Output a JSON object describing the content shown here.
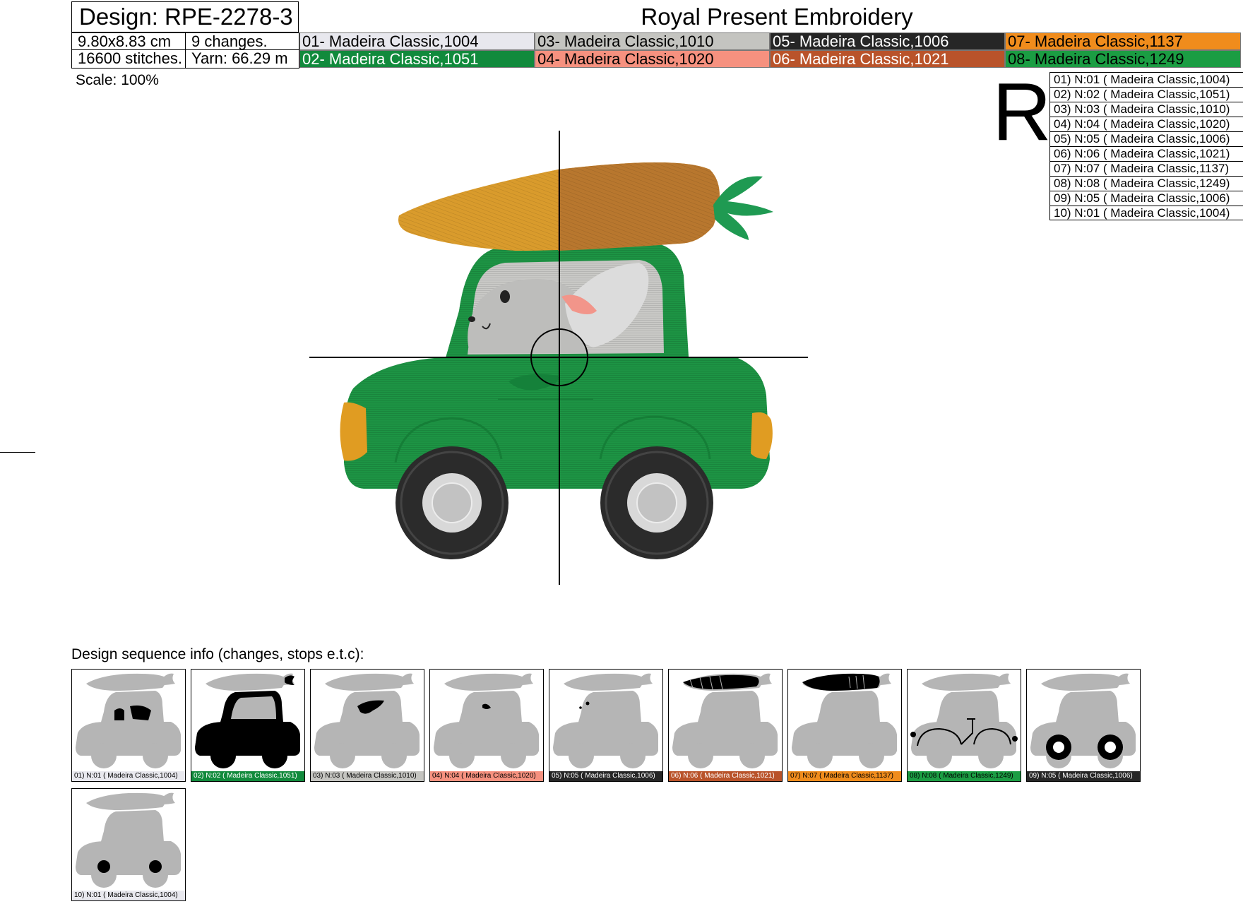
{
  "header": {
    "design": "Design: RPE-2278-3",
    "brand": "Royal Present Embroidery",
    "size": "9.80x8.83 cm",
    "changes": "9 changes.",
    "stitches": "16600 stitches.",
    "yarn": "Yarn: 66.29 m"
  },
  "colors": [
    {
      "label": "01- Madeira Classic,1004",
      "bg": "#e8e8ee",
      "fg": "#000000"
    },
    {
      "label": "02- Madeira Classic,1051",
      "bg": "#118a3c",
      "fg": "#ffffff"
    },
    {
      "label": "03- Madeira Classic,1010",
      "bg": "#c4c4c0",
      "fg": "#000000"
    },
    {
      "label": "04- Madeira Classic,1020",
      "bg": "#f6917f",
      "fg": "#000000"
    },
    {
      "label": "05- Madeira Classic,1006",
      "bg": "#262626",
      "fg": "#ffffff"
    },
    {
      "label": "06- Madeira Classic,1021",
      "bg": "#b9532a",
      "fg": "#ffffff"
    },
    {
      "label": "07- Madeira Classic,1137",
      "bg": "#f08c1c",
      "fg": "#000000"
    },
    {
      "label": "08- Madeira Classic,1249",
      "bg": "#1b9d43",
      "fg": "#000000"
    }
  ],
  "scale": "Scale: 100%",
  "r_letter": "R",
  "stops": [
    "01) N:01 ( Madeira Classic,1004)",
    "02) N:02 ( Madeira Classic,1051)",
    "03) N:03 ( Madeira Classic,1010)",
    "04) N:04 ( Madeira Classic,1020)",
    "05) N:05 ( Madeira Classic,1006)",
    "06) N:06 ( Madeira Classic,1021)",
    "07) N:07 ( Madeira Classic,1137)",
    "08) N:08 ( Madeira Classic,1249)",
    "09) N:05 ( Madeira Classic,1006)",
    "10) N:01 ( Madeira Classic,1004)"
  ],
  "sequence_label": "Design sequence info (changes, stops e.t.c):",
  "thumbnails": [
    {
      "caption": "01) N:01 ( Madeira Classic,1004)",
      "bg": "#e8e8ee",
      "fg": "#000000",
      "highlight": "windows"
    },
    {
      "caption": "02) N:02 ( Madeira Classic,1051)",
      "bg": "#118a3c",
      "fg": "#ffffff",
      "highlight": "body"
    },
    {
      "caption": "03) N:03 ( Madeira Classic,1010)",
      "bg": "#c4c4c0",
      "fg": "#000000",
      "highlight": "ear"
    },
    {
      "caption": "04) N:04 ( Madeira Classic,1020)",
      "bg": "#f6917f",
      "fg": "#000000",
      "highlight": "inner-ear"
    },
    {
      "caption": "05) N:05 ( Madeira Classic,1006)",
      "bg": "#262626",
      "fg": "#ffffff",
      "highlight": "face"
    },
    {
      "caption": "06) N:06 ( Madeira Classic,1021)",
      "bg": "#b9532a",
      "fg": "#ffffff",
      "highlight": "carrot-stripes"
    },
    {
      "caption": "07) N:07 ( Madeira Classic,1137)",
      "bg": "#f08c1c",
      "fg": "#000000",
      "highlight": "carrot"
    },
    {
      "caption": "08) N:08 ( Madeira Classic,1249)",
      "bg": "#1b9d43",
      "fg": "#000000",
      "highlight": "details"
    },
    {
      "caption": "09) N:05 ( Madeira Classic,1006)",
      "bg": "#262626",
      "fg": "#ffffff",
      "highlight": "tires"
    },
    {
      "caption": "10) N:01 ( Madeira Classic,1004)",
      "bg": "#e8e8ee",
      "fg": "#000000",
      "highlight": "hubs"
    }
  ]
}
